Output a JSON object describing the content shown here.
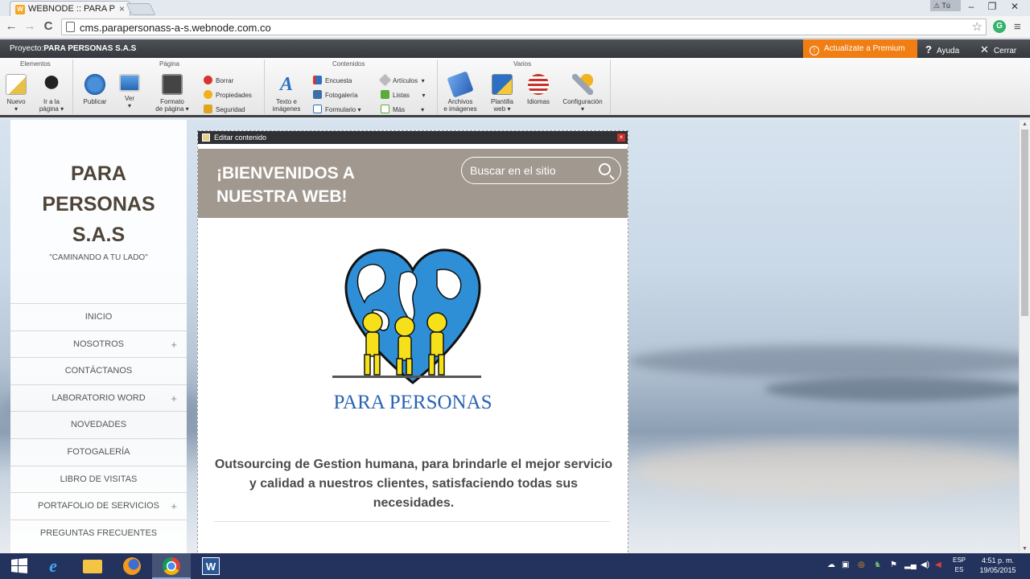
{
  "browser": {
    "tab_title": "WEBNODE :: PARA PERSO",
    "tab_close": "×",
    "tab_favicon": "W",
    "user_badge": "Tú",
    "url": "cms.parapersonass-a-s.webnode.com.co",
    "back": "←",
    "forward": "→",
    "reload": "C",
    "star": "☆",
    "extension": "G",
    "menu": "≡",
    "minimize": "–",
    "maximize": "❐",
    "close": "✕"
  },
  "projectbar": {
    "prefix": "Proyecto:",
    "name": "PARA PERSONAS S.A.S",
    "premium": "Actualízate a Premium",
    "help": "Ayuda",
    "close": "Cerrar"
  },
  "ribbon": {
    "groups": {
      "elementos": "Elementos",
      "pagina": "Página",
      "contenidos": "Contenidos",
      "varios": "Varios"
    },
    "nuevo": "Nuevo",
    "ir_a": "Ir a la",
    "ir_a2": "página",
    "publicar": "Publicar",
    "ver": "Ver",
    "formato": "Formato",
    "formato2": "de página",
    "borrar": "Borrar",
    "propiedades": "Propiedades",
    "seguridad": "Seguridad",
    "texto": "Texto e",
    "texto2": "imágenes",
    "encuesta": "Encuesta",
    "fotogaleria": "Fotogalería",
    "formulario": "Formulario",
    "articulos": "Artículos",
    "listas": "Listas",
    "mas": "Más",
    "archivos": "Archivos",
    "archivos2": "e imágenes",
    "plantilla": "Plantilla",
    "plantilla2": "web",
    "idiomas": "Idiomas",
    "configuracion": "Configuración"
  },
  "site": {
    "title_line1": "PARA",
    "title_line2": "PERSONAS",
    "title_line3": "S.A.S",
    "slogan": "\"CAMINANDO A TU LADO\"",
    "menu": [
      {
        "label": "INICIO",
        "plus": ""
      },
      {
        "label": "NOSOTROS",
        "plus": "+"
      },
      {
        "label": "CONTÁCTANOS",
        "plus": ""
      },
      {
        "label": "LABORATORIO WORD",
        "plus": "+"
      },
      {
        "label": "NOVEDADES",
        "plus": ""
      },
      {
        "label": "FOTOGALERÍA",
        "plus": ""
      },
      {
        "label": "LIBRO DE VISITAS",
        "plus": ""
      },
      {
        "label": "PORTAFOLIO DE SERVICIOS",
        "plus": "+"
      },
      {
        "label": "PREGUNTAS FRECUENTES",
        "plus": ""
      }
    ],
    "edit_label": "Editar contenido",
    "edit_close": "×",
    "hero_title": "¡BIENVENIDOS A NUESTRA WEB!",
    "search_placeholder": "Buscar en el sitio",
    "logo_caption": "PARA PERSONAS",
    "tagline": "Outsourcing de Gestion humana, para brindarle el mejor servicio y calidad a nuestros clientes, satisfaciendo todas sus necesidades."
  },
  "taskbar": {
    "lang1": "ESP",
    "lang2": "ES",
    "time": "4:51 p. m.",
    "date": "19/05/2015"
  },
  "colors": {
    "premium": "#f07e13",
    "hero": "#a1988f",
    "title_text": "#4e4438",
    "logo_blue": "#2a62b3",
    "taskbar": "#24325e"
  }
}
